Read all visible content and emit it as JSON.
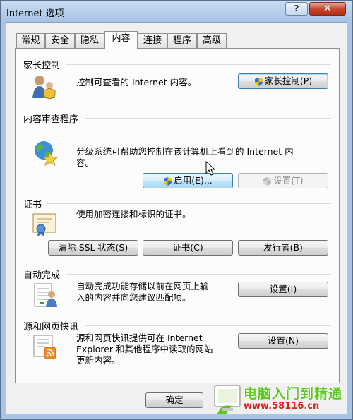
{
  "window": {
    "title": "Internet 选项",
    "help_label": "?",
    "close_label": "✕"
  },
  "tabs": [
    {
      "label": "常规"
    },
    {
      "label": "安全"
    },
    {
      "label": "隐私"
    },
    {
      "label": "内容",
      "active": true
    },
    {
      "label": "连接"
    },
    {
      "label": "程序"
    },
    {
      "label": "高级"
    }
  ],
  "parental": {
    "title": "家长控制",
    "desc": "控制可查看的 Internet 内容。",
    "button": "家长控制(P)"
  },
  "advisor": {
    "title": "内容审查程序",
    "desc_line1": "分级系统可帮助您控制在该计算机上看到的 Internet 内",
    "desc_line2": "容。",
    "enable_button": "启用(E)...",
    "settings_button": "设置(T)"
  },
  "certificates": {
    "title": "证书",
    "desc": "使用加密连接和标识的证书。",
    "clear_ssl_button": "清除 SSL 状态(S)",
    "certificates_button": "证书(C)",
    "publishers_button": "发行者(B)"
  },
  "autocomplete": {
    "title": "自动完成",
    "desc_line1": "自动完成功能存储以前在网页上输",
    "desc_line2": "入的内容并向您建议匹配项。",
    "settings_button": "设置(I)"
  },
  "feeds": {
    "title": "源和网页快讯",
    "desc_line1": "源和网页快讯提供可在 Internet",
    "desc_line2": "Explorer 和其他程序中读取的网站",
    "desc_line3": "更新内容。",
    "settings_button": "设置(N)"
  },
  "footer": {
    "ok_button": "确定"
  },
  "watermark": {
    "line1": "电脑入门到精通",
    "line2": "www.58116.cn"
  },
  "colors": {
    "title_bar": "#a7c3e4",
    "close_button": "#c7432b",
    "button_hover": "#bee6fd",
    "watermark_green": "#5cc71d",
    "watermark_red": "#d9261c"
  }
}
